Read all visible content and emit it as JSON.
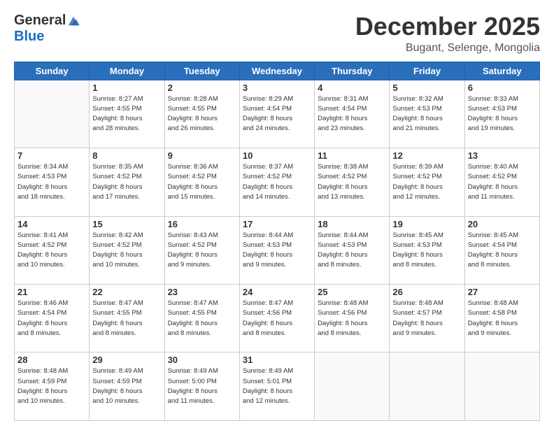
{
  "logo": {
    "general": "General",
    "blue": "Blue"
  },
  "header": {
    "month": "December 2025",
    "location": "Bugant, Selenge, Mongolia"
  },
  "days_of_week": [
    "Sunday",
    "Monday",
    "Tuesday",
    "Wednesday",
    "Thursday",
    "Friday",
    "Saturday"
  ],
  "weeks": [
    [
      {
        "day": "",
        "info": ""
      },
      {
        "day": "1",
        "info": "Sunrise: 8:27 AM\nSunset: 4:55 PM\nDaylight: 8 hours\nand 28 minutes."
      },
      {
        "day": "2",
        "info": "Sunrise: 8:28 AM\nSunset: 4:55 PM\nDaylight: 8 hours\nand 26 minutes."
      },
      {
        "day": "3",
        "info": "Sunrise: 8:29 AM\nSunset: 4:54 PM\nDaylight: 8 hours\nand 24 minutes."
      },
      {
        "day": "4",
        "info": "Sunrise: 8:31 AM\nSunset: 4:54 PM\nDaylight: 8 hours\nand 23 minutes."
      },
      {
        "day": "5",
        "info": "Sunrise: 8:32 AM\nSunset: 4:53 PM\nDaylight: 8 hours\nand 21 minutes."
      },
      {
        "day": "6",
        "info": "Sunrise: 8:33 AM\nSunset: 4:53 PM\nDaylight: 8 hours\nand 19 minutes."
      }
    ],
    [
      {
        "day": "7",
        "info": "Sunrise: 8:34 AM\nSunset: 4:53 PM\nDaylight: 8 hours\nand 18 minutes."
      },
      {
        "day": "8",
        "info": "Sunrise: 8:35 AM\nSunset: 4:52 PM\nDaylight: 8 hours\nand 17 minutes."
      },
      {
        "day": "9",
        "info": "Sunrise: 8:36 AM\nSunset: 4:52 PM\nDaylight: 8 hours\nand 15 minutes."
      },
      {
        "day": "10",
        "info": "Sunrise: 8:37 AM\nSunset: 4:52 PM\nDaylight: 8 hours\nand 14 minutes."
      },
      {
        "day": "11",
        "info": "Sunrise: 8:38 AM\nSunset: 4:52 PM\nDaylight: 8 hours\nand 13 minutes."
      },
      {
        "day": "12",
        "info": "Sunrise: 8:39 AM\nSunset: 4:52 PM\nDaylight: 8 hours\nand 12 minutes."
      },
      {
        "day": "13",
        "info": "Sunrise: 8:40 AM\nSunset: 4:52 PM\nDaylight: 8 hours\nand 11 minutes."
      }
    ],
    [
      {
        "day": "14",
        "info": "Sunrise: 8:41 AM\nSunset: 4:52 PM\nDaylight: 8 hours\nand 10 minutes."
      },
      {
        "day": "15",
        "info": "Sunrise: 8:42 AM\nSunset: 4:52 PM\nDaylight: 8 hours\nand 10 minutes."
      },
      {
        "day": "16",
        "info": "Sunrise: 8:43 AM\nSunset: 4:52 PM\nDaylight: 8 hours\nand 9 minutes."
      },
      {
        "day": "17",
        "info": "Sunrise: 8:44 AM\nSunset: 4:53 PM\nDaylight: 8 hours\nand 9 minutes."
      },
      {
        "day": "18",
        "info": "Sunrise: 8:44 AM\nSunset: 4:53 PM\nDaylight: 8 hours\nand 8 minutes."
      },
      {
        "day": "19",
        "info": "Sunrise: 8:45 AM\nSunset: 4:53 PM\nDaylight: 8 hours\nand 8 minutes."
      },
      {
        "day": "20",
        "info": "Sunrise: 8:45 AM\nSunset: 4:54 PM\nDaylight: 8 hours\nand 8 minutes."
      }
    ],
    [
      {
        "day": "21",
        "info": "Sunrise: 8:46 AM\nSunset: 4:54 PM\nDaylight: 8 hours\nand 8 minutes."
      },
      {
        "day": "22",
        "info": "Sunrise: 8:47 AM\nSunset: 4:55 PM\nDaylight: 8 hours\nand 8 minutes."
      },
      {
        "day": "23",
        "info": "Sunrise: 8:47 AM\nSunset: 4:55 PM\nDaylight: 8 hours\nand 8 minutes."
      },
      {
        "day": "24",
        "info": "Sunrise: 8:47 AM\nSunset: 4:56 PM\nDaylight: 8 hours\nand 8 minutes."
      },
      {
        "day": "25",
        "info": "Sunrise: 8:48 AM\nSunset: 4:56 PM\nDaylight: 8 hours\nand 8 minutes."
      },
      {
        "day": "26",
        "info": "Sunrise: 8:48 AM\nSunset: 4:57 PM\nDaylight: 8 hours\nand 9 minutes."
      },
      {
        "day": "27",
        "info": "Sunrise: 8:48 AM\nSunset: 4:58 PM\nDaylight: 8 hours\nand 9 minutes."
      }
    ],
    [
      {
        "day": "28",
        "info": "Sunrise: 8:48 AM\nSunset: 4:59 PM\nDaylight: 8 hours\nand 10 minutes."
      },
      {
        "day": "29",
        "info": "Sunrise: 8:49 AM\nSunset: 4:59 PM\nDaylight: 8 hours\nand 10 minutes."
      },
      {
        "day": "30",
        "info": "Sunrise: 8:49 AM\nSunset: 5:00 PM\nDaylight: 8 hours\nand 11 minutes."
      },
      {
        "day": "31",
        "info": "Sunrise: 8:49 AM\nSunset: 5:01 PM\nDaylight: 8 hours\nand 12 minutes."
      },
      {
        "day": "",
        "info": ""
      },
      {
        "day": "",
        "info": ""
      },
      {
        "day": "",
        "info": ""
      }
    ]
  ]
}
